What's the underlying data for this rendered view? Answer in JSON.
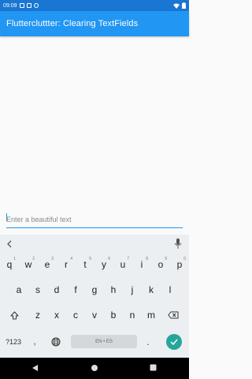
{
  "status_bar": {
    "time": "09:09",
    "color": "#1976d2"
  },
  "app_bar": {
    "title": "Fluttercluttter: Clearing TextFields",
    "color": "#2196f3"
  },
  "text_field": {
    "placeholder": "Enter a beautiful text",
    "value": "",
    "accent_color": "#2196f3"
  },
  "keyboard": {
    "row1": [
      {
        "key": "q",
        "hint": "1"
      },
      {
        "key": "w",
        "hint": "2"
      },
      {
        "key": "e",
        "hint": "3"
      },
      {
        "key": "r",
        "hint": "4"
      },
      {
        "key": "t",
        "hint": "5"
      },
      {
        "key": "y",
        "hint": "6"
      },
      {
        "key": "u",
        "hint": "7"
      },
      {
        "key": "i",
        "hint": "8"
      },
      {
        "key": "o",
        "hint": "9"
      },
      {
        "key": "p",
        "hint": "0"
      }
    ],
    "row2": [
      "a",
      "s",
      "d",
      "f",
      "g",
      "h",
      "j",
      "k",
      "l"
    ],
    "row3": [
      "z",
      "x",
      "c",
      "v",
      "b",
      "n",
      "m"
    ],
    "symbols_label": "?123",
    "comma_label": ",",
    "space_label": "EN • ES",
    "period_label": ".",
    "enter_color": "#26a69a"
  },
  "icons": {
    "suggestion": "chevron-left-icon",
    "mic": "mic-icon",
    "shift": "shift-icon",
    "backspace": "backspace-icon",
    "globe": "globe-icon",
    "enter": "check-icon",
    "nav_back": "back-triangle-icon",
    "nav_home": "home-circle-icon",
    "nav_recents": "recents-square-icon"
  }
}
